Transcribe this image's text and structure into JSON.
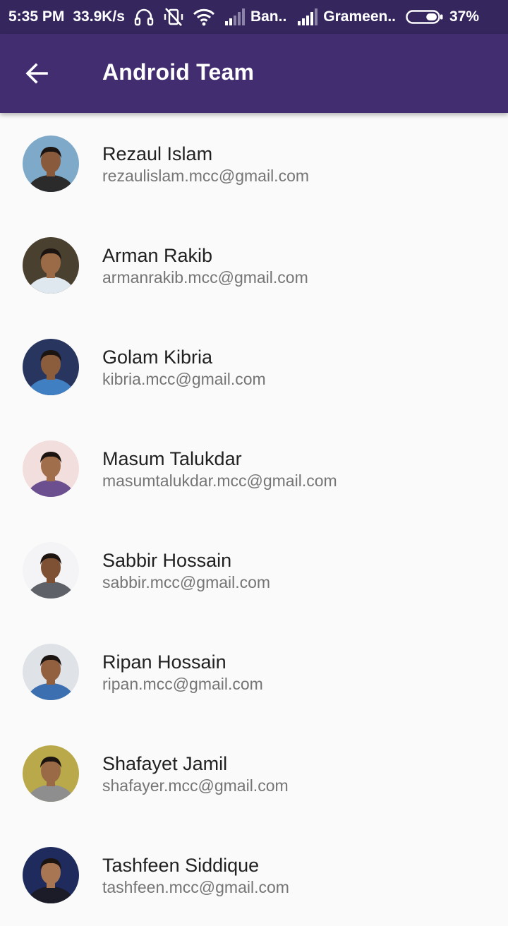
{
  "status_bar": {
    "time": "5:35 PM",
    "net_speed": "33.9K/s",
    "icons": [
      "headphones-icon",
      "vibrate-off-icon",
      "wifi-icon",
      "signal-icon",
      "signal-icon",
      "battery-icon"
    ],
    "carrier_1": "Ban..",
    "carrier_2": "Grameen..",
    "battery": "37%",
    "battery_level": 0.37
  },
  "app_bar": {
    "title": "Android Team",
    "back_icon": "arrow-back-icon"
  },
  "members": [
    {
      "name": "Rezaul Islam",
      "email": "rezaulislam.mcc@gmail.com",
      "bg": "#7fa9c9",
      "skin": "#8a5a3c",
      "shirt": "#2b2b2b"
    },
    {
      "name": "Arman Rakib",
      "email": "armanrakib.mcc@gmail.com",
      "bg": "#4a4030",
      "skin": "#9b6b47",
      "shirt": "#dfe8ef"
    },
    {
      "name": "Golam Kibria",
      "email": "kibria.mcc@gmail.com",
      "bg": "#27355f",
      "skin": "#8c5d3d",
      "shirt": "#3f7fc2"
    },
    {
      "name": "Masum Talukdar",
      "email": "masumtalukdar.mcc@gmail.com",
      "bg": "#f3dede",
      "skin": "#a06e4a",
      "shirt": "#6b4f8f"
    },
    {
      "name": "Sabbir Hossain",
      "email": "sabbir.mcc@gmail.com",
      "bg": "#f4f4f6",
      "skin": "#7e5034",
      "shirt": "#5f6168"
    },
    {
      "name": "Ripan Hossain",
      "email": "ripan.mcc@gmail.com",
      "bg": "#dfe3e8",
      "skin": "#93603f",
      "shirt": "#3c6fb0"
    },
    {
      "name": "Shafayet Jamil",
      "email": "shafayer.mcc@gmail.com",
      "bg": "#b9a94a",
      "skin": "#9a6a46",
      "shirt": "#8e8e8e"
    },
    {
      "name": "Tashfeen Siddique",
      "email": "tashfeen.mcc@gmail.com",
      "bg": "#1e2b5c",
      "skin": "#a87653",
      "shirt": "#1c1c28"
    }
  ]
}
